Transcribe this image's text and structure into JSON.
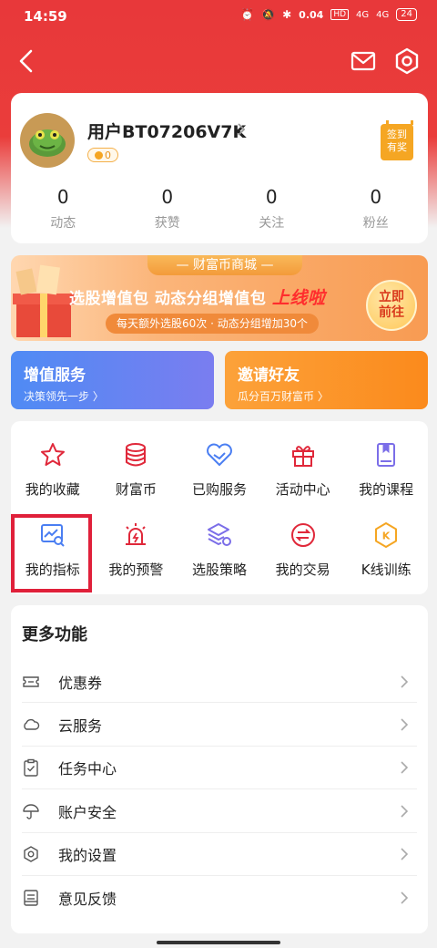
{
  "status_bar": {
    "time": "14:59",
    "network_speed": "0.04",
    "network_unit": "KB/S",
    "hd_label": "HD",
    "signal_1": "4G",
    "signal_2": "4G",
    "battery": "24"
  },
  "profile": {
    "username": "用户BT07206V7K",
    "coins": "0",
    "checkin_line1": "签到",
    "checkin_line2": "有奖",
    "stats": [
      {
        "value": "0",
        "label": "动态"
      },
      {
        "value": "0",
        "label": "获赞"
      },
      {
        "value": "0",
        "label": "关注"
      },
      {
        "value": "0",
        "label": "粉丝"
      }
    ]
  },
  "banner": {
    "tab": "— 财富币商城 —",
    "title_main": "选股增值包  动态分组增值包",
    "title_highlight": "上线啦",
    "subtitle": "每天额外选股60次 · 动态分组增加30个",
    "go_line1": "立即",
    "go_line2": "前往"
  },
  "promos": [
    {
      "title": "增值服务",
      "sub": "决策领先一步 〉"
    },
    {
      "title": "邀请好友",
      "sub": "瓜分百万财富币 〉"
    }
  ],
  "services_row1": [
    {
      "label": "我的收藏",
      "icon": "star-icon"
    },
    {
      "label": "财富币",
      "icon": "coin-stack-icon"
    },
    {
      "label": "已购服务",
      "icon": "diamond-icon"
    },
    {
      "label": "活动中心",
      "icon": "gift-icon"
    },
    {
      "label": "我的课程",
      "icon": "book-icon"
    }
  ],
  "services_row2": [
    {
      "label": "我的指标",
      "icon": "chart-search-icon"
    },
    {
      "label": "我的预警",
      "icon": "alarm-icon"
    },
    {
      "label": "选股策略",
      "icon": "layers-icon"
    },
    {
      "label": "我的交易",
      "icon": "exchange-icon"
    },
    {
      "label": "K线训练",
      "icon": "k-line-icon"
    }
  ],
  "more": {
    "title": "更多功能",
    "items": [
      {
        "label": "优惠券",
        "icon": "ticket-icon"
      },
      {
        "label": "云服务",
        "icon": "cloud-icon"
      },
      {
        "label": "任务中心",
        "icon": "clipboard-icon"
      },
      {
        "label": "账户安全",
        "icon": "umbrella-icon"
      },
      {
        "label": "我的设置",
        "icon": "gear-icon"
      },
      {
        "label": "意见反馈",
        "icon": "feedback-icon"
      }
    ]
  },
  "colors": {
    "header_red": "#e8383a",
    "service_red": "#e0283a",
    "service_blue": "#4a7ef2",
    "service_purple": "#7b6ee8",
    "service_orange": "#f5a623",
    "highlight_border": "#e0203a"
  }
}
